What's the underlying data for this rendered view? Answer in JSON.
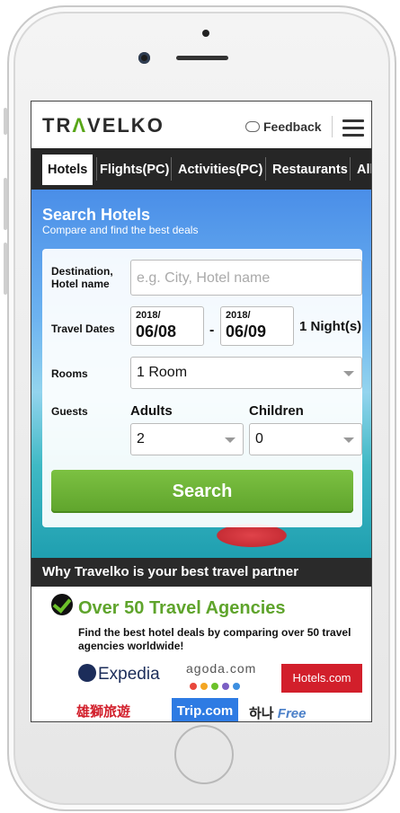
{
  "header": {
    "logo_left": "TR",
    "logo_mark": "Λ",
    "logo_right": "VELKO",
    "feedback_label": "Feedback"
  },
  "tabs": [
    {
      "label": "Hotels",
      "active": true
    },
    {
      "label": "Flights(PC)"
    },
    {
      "label": "Activities(PC)"
    },
    {
      "label": "Restaurants"
    },
    {
      "label": "All J"
    }
  ],
  "search": {
    "title": "Search Hotels",
    "subtitle": "Compare and find the best deals",
    "destination_label": "Destination, Hotel name",
    "destination_placeholder": "e.g. City, Hotel name",
    "travel_dates_label": "Travel Dates",
    "checkin_year": "2018/",
    "checkin_date": "06/08",
    "date_sep": "-",
    "checkout_year": "2018/",
    "checkout_date": "06/09",
    "nights": "1 Night(s)",
    "rooms_label": "Rooms",
    "rooms_value": "1 Room",
    "guests_label": "Guests",
    "adults_label": "Adults",
    "adults_value": "2",
    "children_label": "Children",
    "children_value": "0",
    "search_button": "Search"
  },
  "why": {
    "heading": "Why Travelko is your best travel partner",
    "agencies_title": "Over 50 Travel Agencies",
    "agencies_text": "Find the best hotel deals by comparing over 50 travel agencies worldwide!"
  },
  "partners": {
    "expedia": "Expedia",
    "agoda": "agoda.com",
    "hotels": "Hotels.com",
    "lion": "雄獅旅遊",
    "trip": "Trip.com",
    "hana": "하나",
    "hana_free": "Free"
  },
  "colors": {
    "brand_green": "#5fa42c",
    "tab_bar": "#262626",
    "hotels_red": "#d21f2b",
    "trip_blue": "#2e7be3"
  }
}
